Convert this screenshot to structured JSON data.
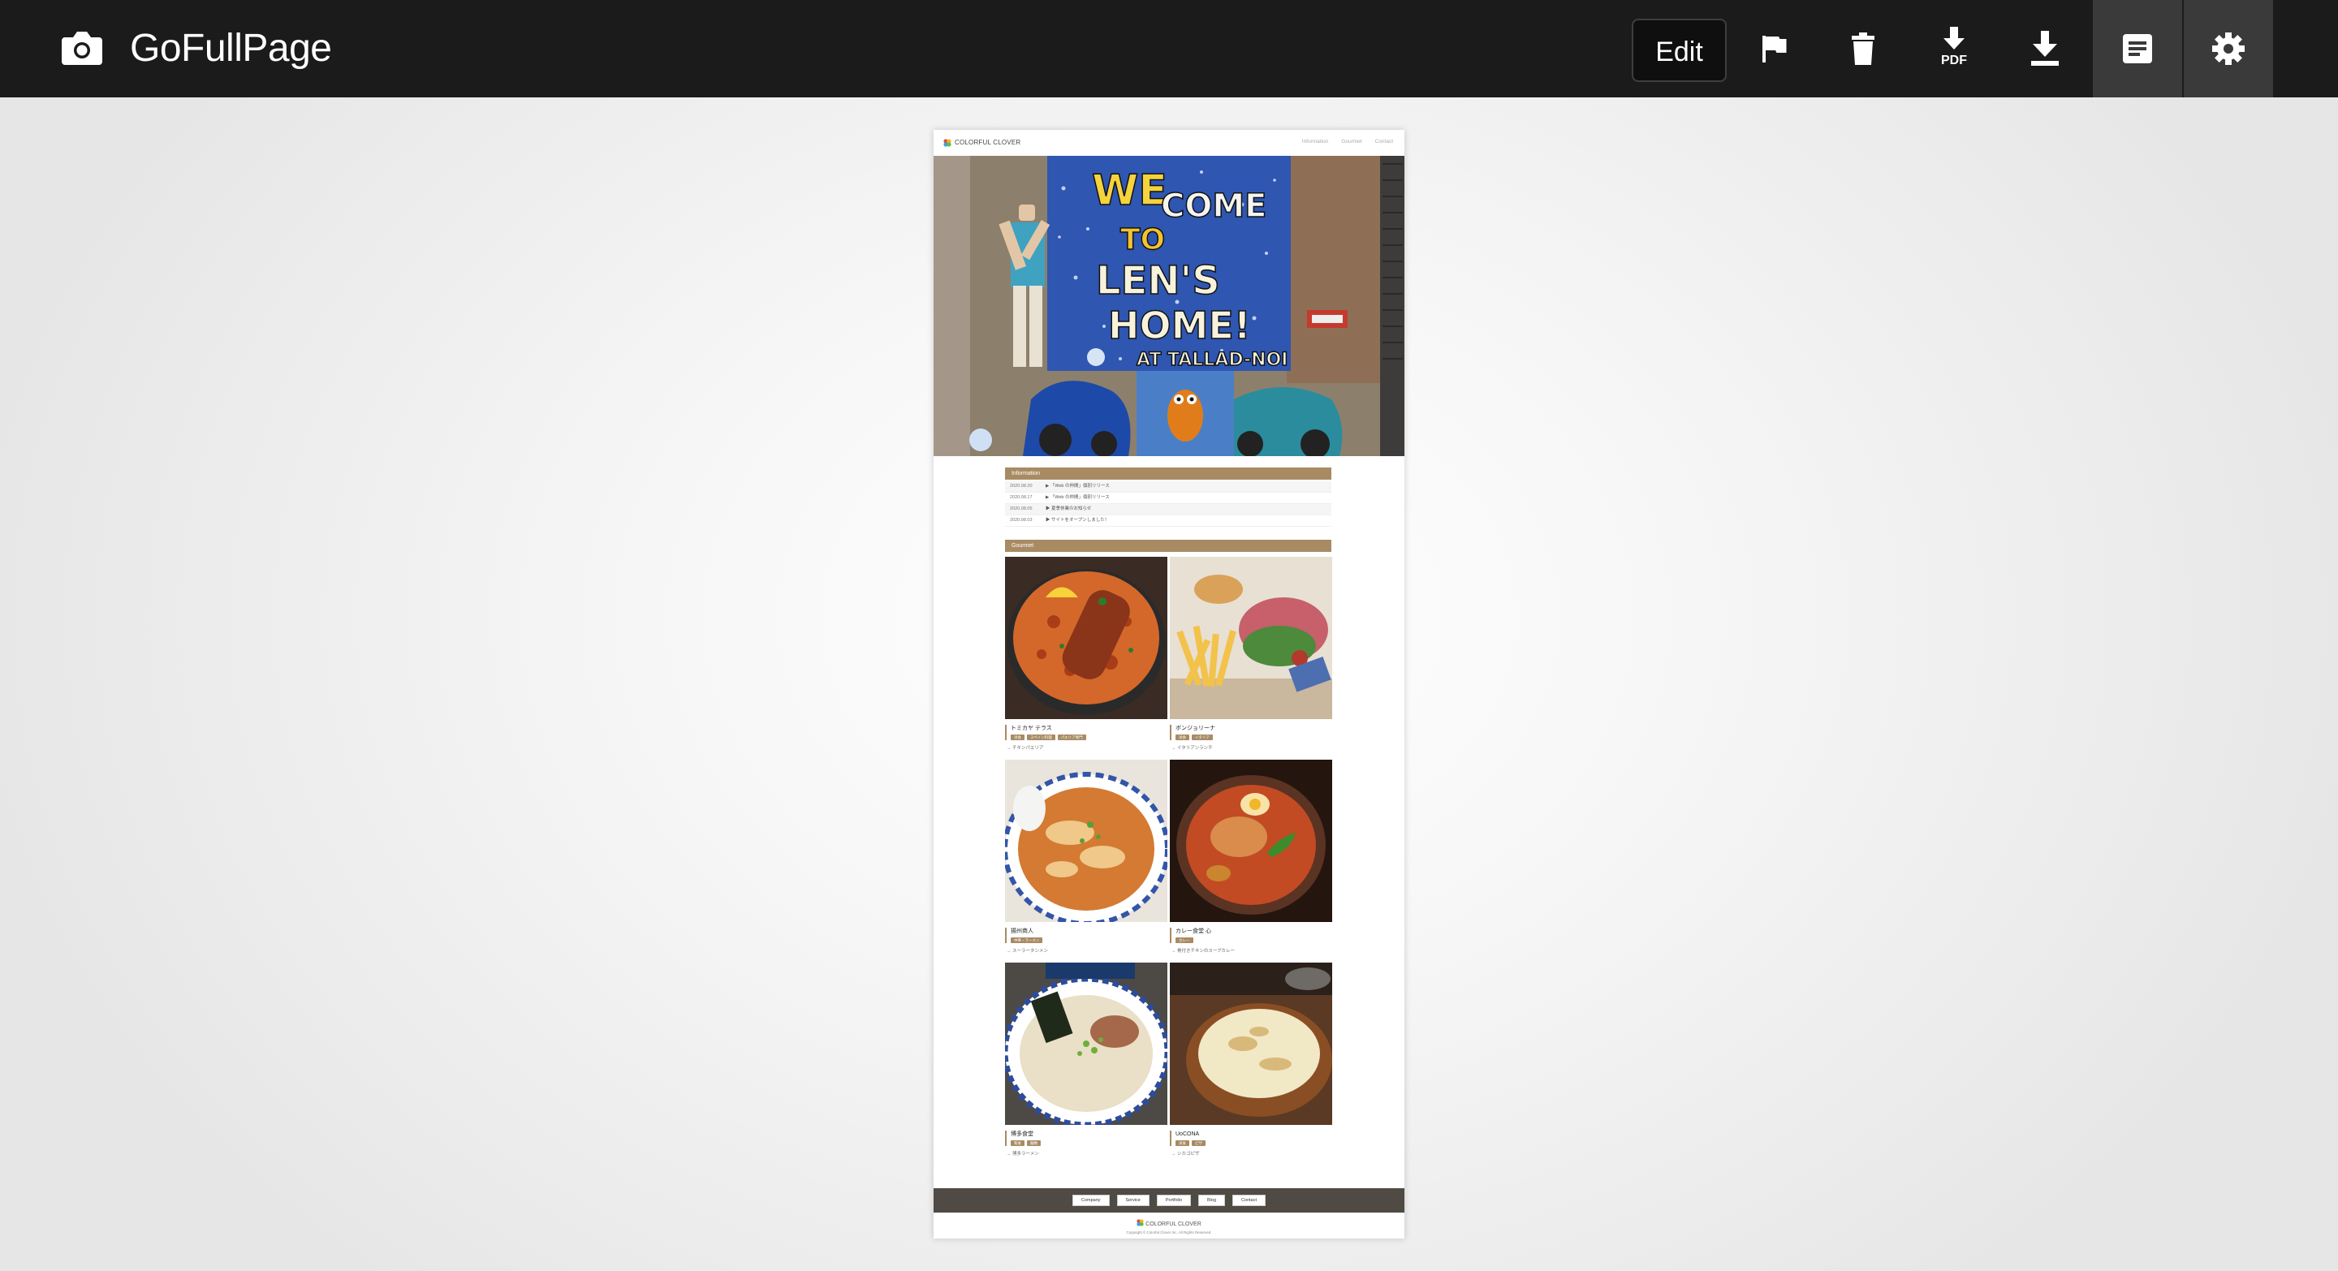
{
  "app": {
    "title": "GoFullPage",
    "icon": "camera-icon"
  },
  "toolbar": {
    "edit_label": "Edit",
    "buttons": [
      {
        "name": "flag-icon"
      },
      {
        "name": "trash-icon"
      },
      {
        "name": "download-pdf-icon",
        "label": "PDF"
      },
      {
        "name": "download-image-icon"
      },
      {
        "name": "document-list-icon",
        "active": true
      },
      {
        "name": "settings-gear-icon",
        "active": true
      }
    ]
  },
  "screenshot": {
    "brand": "COLORFUL CLOVER",
    "nav": [
      "Information",
      "Gourmet",
      "Contact"
    ],
    "hero": {
      "text_lines": [
        "WELCOME",
        "TO",
        "LEN'S",
        "HOME!",
        "AT TALLAD-NOI"
      ]
    },
    "information": {
      "heading": "Information",
      "rows": [
        {
          "date": "2020.08.20",
          "text": "「Web の仲間」個別リリース"
        },
        {
          "date": "2020.08.17",
          "text": "「Web の仲間」個別リリース"
        },
        {
          "date": "2020.08.05",
          "text": "夏季休業のお知らせ"
        },
        {
          "date": "2020.08.03",
          "text": "サイトをオープンしました！"
        }
      ]
    },
    "gourmet": {
      "heading": "Gourmet",
      "items": [
        {
          "name": "トミカヤ テラス",
          "tags": [
            "洋食",
            "スペイン料理",
            "パエリア専門"
          ],
          "desc": "→ チキンパエリア"
        },
        {
          "name": "ボンジョリーナ",
          "tags": [
            "洋食",
            "イタリア"
          ],
          "desc": "→ イタリアンランチ"
        },
        {
          "name": "揚州商人",
          "tags": [
            "中華・ラーメン"
          ],
          "desc": "→ スーラータンメン"
        },
        {
          "name": "カレー食堂 心",
          "tags": [
            "カレー"
          ],
          "desc": "→ 骨付きチキンのスープカレー"
        },
        {
          "name": "博多食堂",
          "tags": [
            "和食",
            "麺類"
          ],
          "desc": "→ 博多ラーメン"
        },
        {
          "name": "UoCONA",
          "tags": [
            "洋食",
            "ピザ"
          ],
          "desc": "→ シカゴピザ"
        }
      ]
    },
    "footer": {
      "links": [
        "Company",
        "Service",
        "Portfolio",
        "Blog",
        "Contact"
      ],
      "brand": "COLORFUL CLOVER",
      "copyright": "Copyright © Colorful Clover Inc. All Rights Reserved."
    }
  },
  "colors": {
    "topbar": "#1b1b1b",
    "accent": "#a88b63",
    "footer": "#4f4a43"
  }
}
